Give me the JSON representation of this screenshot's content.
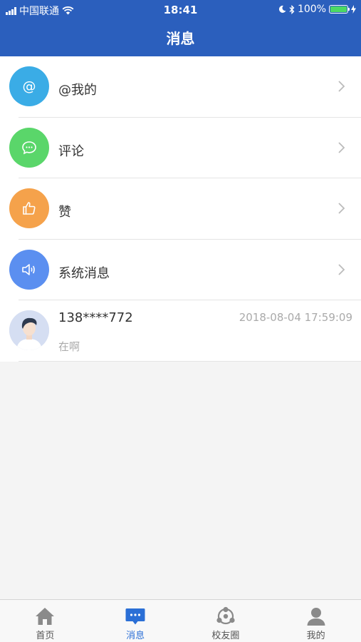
{
  "status_bar": {
    "carrier": "中国联通",
    "time": "18:41",
    "battery_percent": "100%",
    "battery_level": 1.0
  },
  "header": {
    "title": "消息"
  },
  "categories": [
    {
      "label": "@我的",
      "icon": "at-icon",
      "color": "#3aace6"
    },
    {
      "label": "评论",
      "icon": "comment-icon",
      "color": "#5ad66a"
    },
    {
      "label": "赞",
      "icon": "thumbs-up-icon",
      "color": "#f5a24b"
    },
    {
      "label": "系统消息",
      "icon": "speaker-icon",
      "color": "#5b8ff0"
    }
  ],
  "messages": [
    {
      "name": "138****772",
      "time": "2018-08-04 17:59:09",
      "preview": "在啊"
    }
  ],
  "tabbar": {
    "active": "消息",
    "active_color": "#2b6fd6",
    "items": [
      {
        "label": "首页",
        "icon": "home-icon"
      },
      {
        "label": "消息",
        "icon": "message-icon"
      },
      {
        "label": "校友圈",
        "icon": "alumni-circle-icon"
      },
      {
        "label": "我的",
        "icon": "person-icon"
      }
    ]
  },
  "colors": {
    "header_bg": "#2b5fbd",
    "page_bg": "#f4f4f4"
  }
}
